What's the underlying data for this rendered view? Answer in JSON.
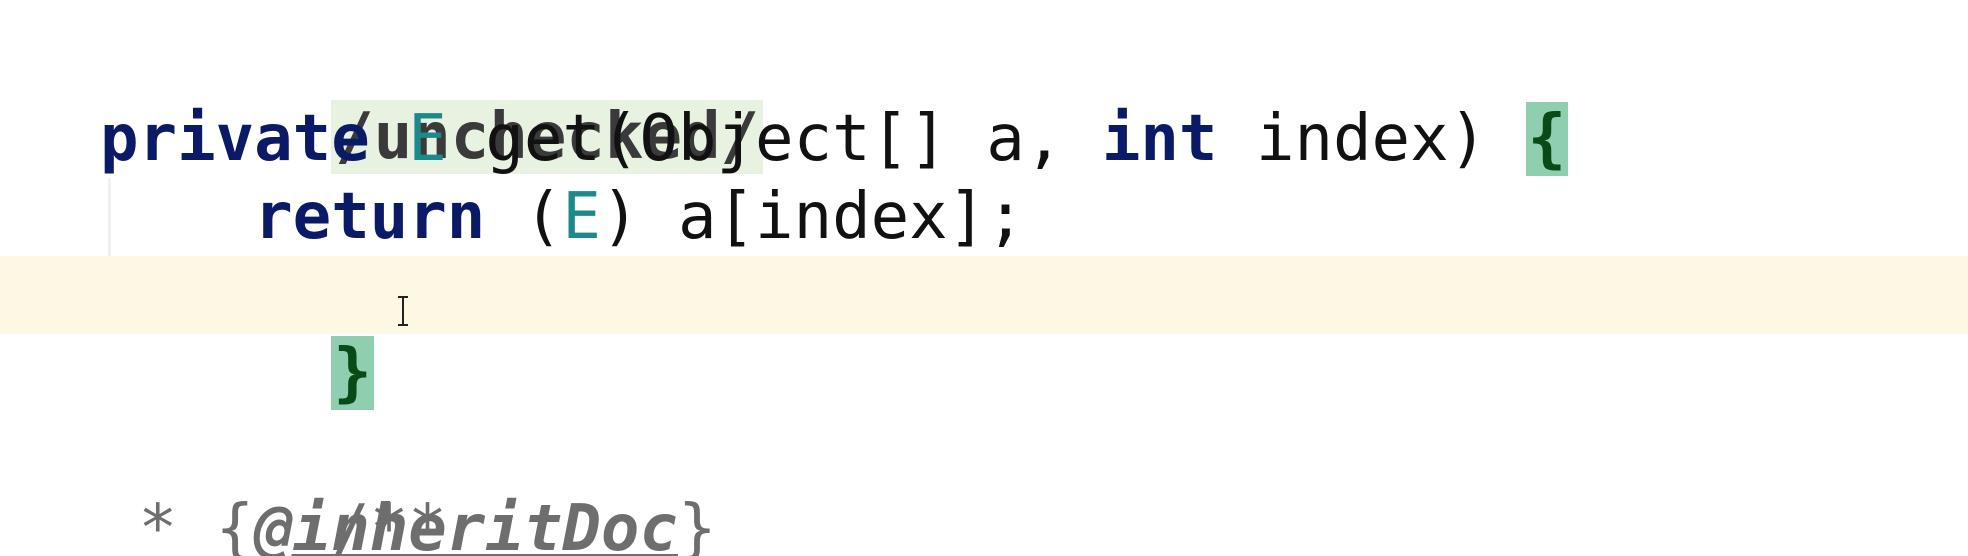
{
  "editor": {
    "annotation_line": {
      "text": "/unchecked/"
    },
    "signature_line": {
      "modifier": "private",
      "return_type": "E",
      "method_name": "get",
      "open_paren": "(",
      "param1_type": "Object[]",
      "param1_name": "a,",
      "param2_type": "int",
      "param2_name": "index",
      "close_paren": ")",
      "open_brace": "{"
    },
    "body_line": {
      "keyword": "return",
      "cast_open": "(",
      "cast_type": "E",
      "cast_close": ")",
      "expression": "a[index];"
    },
    "closing_line": {
      "close_brace": "}"
    },
    "doc_open_line": {
      "text": "/**"
    },
    "doc_tag_line": {
      "prefix": " * {",
      "tag": "@inheritDoc",
      "suffix": "}"
    }
  },
  "colors": {
    "keyword": "#0b1a66",
    "type_param": "#1c8a8a",
    "brace_highlight": "#8fcfb0",
    "current_line": "#fdf8e3",
    "comment": "#6e6e6e"
  }
}
